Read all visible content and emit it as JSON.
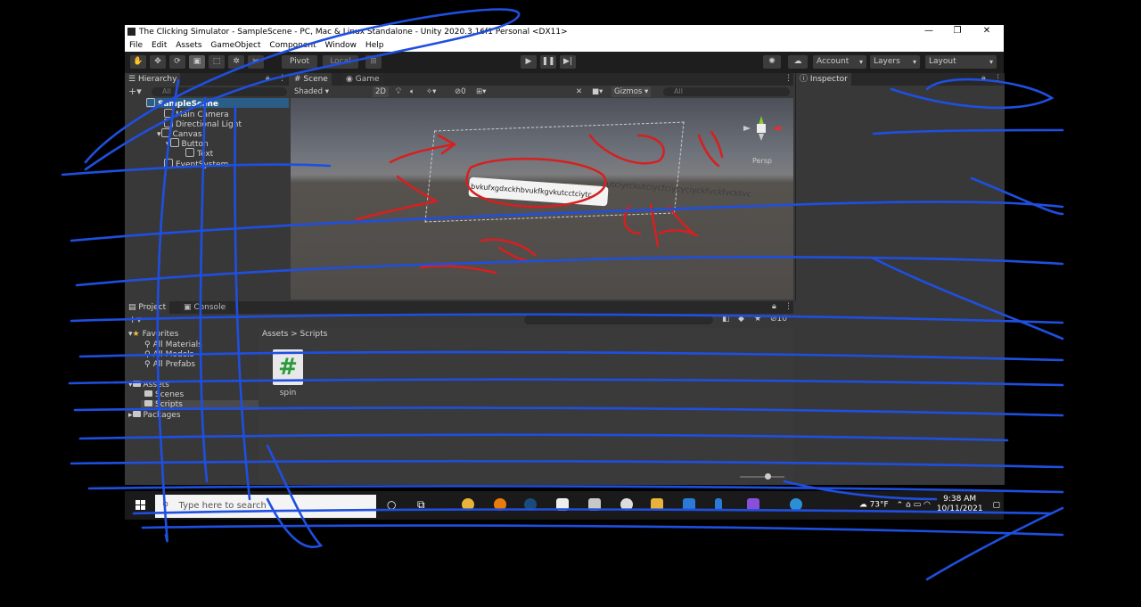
{
  "window": {
    "title": "The Clicking Simulator - SampleScene - PC, Mac & Linux Standalone - Unity 2020.3.16f1 Personal <DX11>",
    "controls": [
      "—",
      "❐",
      "✕"
    ]
  },
  "menu": [
    "File",
    "Edit",
    "Assets",
    "GameObject",
    "Component",
    "Window",
    "Help"
  ],
  "toolbar": {
    "pivot": "Pivot",
    "local": "Local",
    "account": "Account",
    "layers": "Layers",
    "layout": "Layout"
  },
  "hierarchy": {
    "tab": "Hierarchy",
    "search_placeholder": "All",
    "scene": "SampleScene",
    "items": [
      {
        "label": "Main Camera",
        "depth": 2
      },
      {
        "label": "Directional Light",
        "depth": 2
      },
      {
        "label": "Canvas",
        "depth": 2
      },
      {
        "label": "Button",
        "depth": 3
      },
      {
        "label": "Text",
        "depth": 4
      },
      {
        "label": "EventSystem",
        "depth": 2
      }
    ]
  },
  "scene_view": {
    "tabs": [
      "Scene",
      "Game"
    ],
    "shading": "Shaded",
    "mode_2d": "2D",
    "fx_count": "0",
    "gizmos": "Gizmos",
    "search_placeholder": "All",
    "button_text": "bvkufxgdxckhbvukfkgvkutcctciytc",
    "overflow_text": "utciyrckutciycfciycyciyckfvckfvcktvc",
    "persp": "Persp"
  },
  "inspector": {
    "tab": "Inspector"
  },
  "project": {
    "tabs": [
      "Project",
      "Console"
    ],
    "hidden_count": "10",
    "favorites": {
      "label": "Favorites",
      "items": [
        "All Materials",
        "All Models",
        "All Prefabs"
      ]
    },
    "assets": {
      "label": "Assets",
      "items": [
        "Scenes",
        "Scripts"
      ]
    },
    "packages": "Packages",
    "breadcrumb": "Assets > Scripts",
    "files": [
      {
        "name": "spin",
        "glyph": "#"
      }
    ]
  },
  "taskbar": {
    "search_placeholder": "Type here to search",
    "weather": "73°F",
    "time": "9:38 AM",
    "date": "10/11/2021"
  },
  "colors": {
    "accent": "#2c5d87",
    "script_icon": "#2a9a3a",
    "scribble_blue": "#1f4fe0",
    "scribble_red": "#d81f1f"
  }
}
